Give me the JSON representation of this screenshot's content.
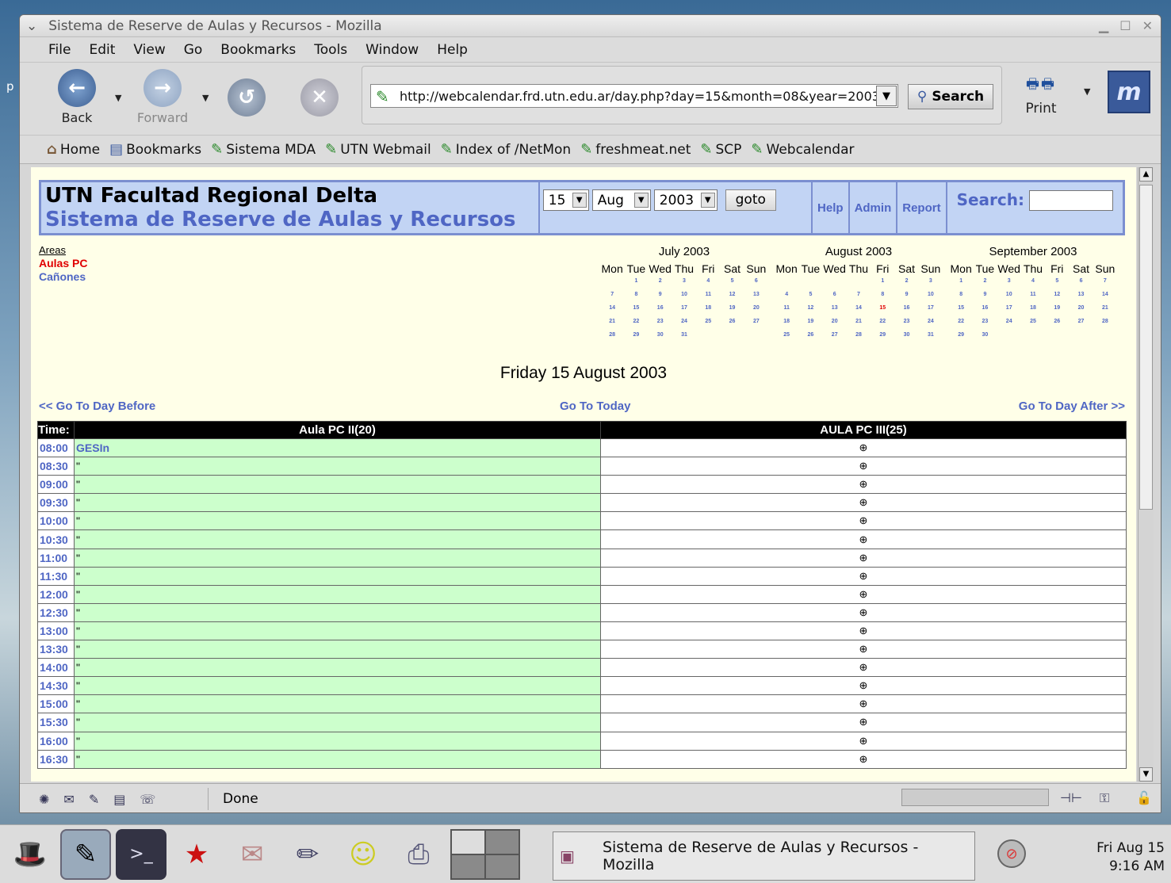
{
  "window": {
    "title": "Sistema de Reserve de Aulas y Recursos - Mozilla",
    "menu": [
      "File",
      "Edit",
      "View",
      "Go",
      "Bookmarks",
      "Tools",
      "Window",
      "Help"
    ]
  },
  "nav": {
    "back_label": "Back",
    "forward_label": "Forward",
    "url": "http://webcalendar.frd.utn.edu.ar/day.php?day=15&month=08&year=2003",
    "search_label": "Search",
    "print_label": "Print"
  },
  "personal_toolbar": [
    "Home",
    "Bookmarks",
    "Sistema MDA",
    "UTN Webmail",
    "Index of /NetMon",
    "freshmeat.net",
    "SCP",
    "Webcalendar"
  ],
  "app": {
    "title1": "UTN Facultad Regional Delta",
    "title2": "Sistema de Reserve de Aulas y Recursos",
    "day_value": "15",
    "month_value": "Aug",
    "year_value": "2003",
    "goto_label": "goto",
    "help_label": "Help",
    "admin_label": "Admin",
    "report_label": "Report",
    "search_label": "Search:"
  },
  "areas": {
    "heading": "Areas",
    "current": "Aulas PC",
    "other": "Cañones"
  },
  "mini_calendars": [
    {
      "title": "July 2003",
      "weekdays": [
        "Mon",
        "Tue",
        "Wed",
        "Thu",
        "Fri",
        "Sat",
        "Sun"
      ],
      "offset": 1,
      "days": 31
    },
    {
      "title": "August 2003",
      "weekdays": [
        "Mon",
        "Tue",
        "Wed",
        "Thu",
        "Fri",
        "Sat",
        "Sun"
      ],
      "offset": 4,
      "days": 31,
      "today": 15
    },
    {
      "title": "September 2003",
      "weekdays": [
        "Mon",
        "Tue",
        "Wed",
        "Thu",
        "Fri",
        "Sat",
        "Sun"
      ],
      "offset": 0,
      "days": 30
    }
  ],
  "day_title": "Friday 15 August 2003",
  "day_nav": {
    "before": "<< Go To Day Before",
    "today": "Go To Today",
    "after": "Go To Day After >>"
  },
  "schedule": {
    "time_header": "Time:",
    "rooms": [
      "Aula PC II(20)",
      "AULA PC III(25)"
    ],
    "booking_name": "GESIn",
    "continuation": "\"",
    "times": [
      "08:00",
      "08:30",
      "09:00",
      "09:30",
      "10:00",
      "10:30",
      "11:00",
      "11:30",
      "12:00",
      "12:30",
      "13:00",
      "13:30",
      "14:00",
      "14:30",
      "15:00",
      "15:30",
      "16:00",
      "16:30"
    ],
    "add_symbol": "⊕"
  },
  "status": {
    "text": "Done"
  },
  "taskbar": {
    "task_title": "Sistema de Reserve de Aulas y Recursos - Mozilla",
    "clock_date": "Fri Aug 15",
    "clock_time": "9:16 AM"
  },
  "colors": {
    "header_bg": "#c2d4f4",
    "link_blue": "#4f66c4",
    "booking_green": "#ccffcc",
    "page_bg": "#ffffe8"
  }
}
